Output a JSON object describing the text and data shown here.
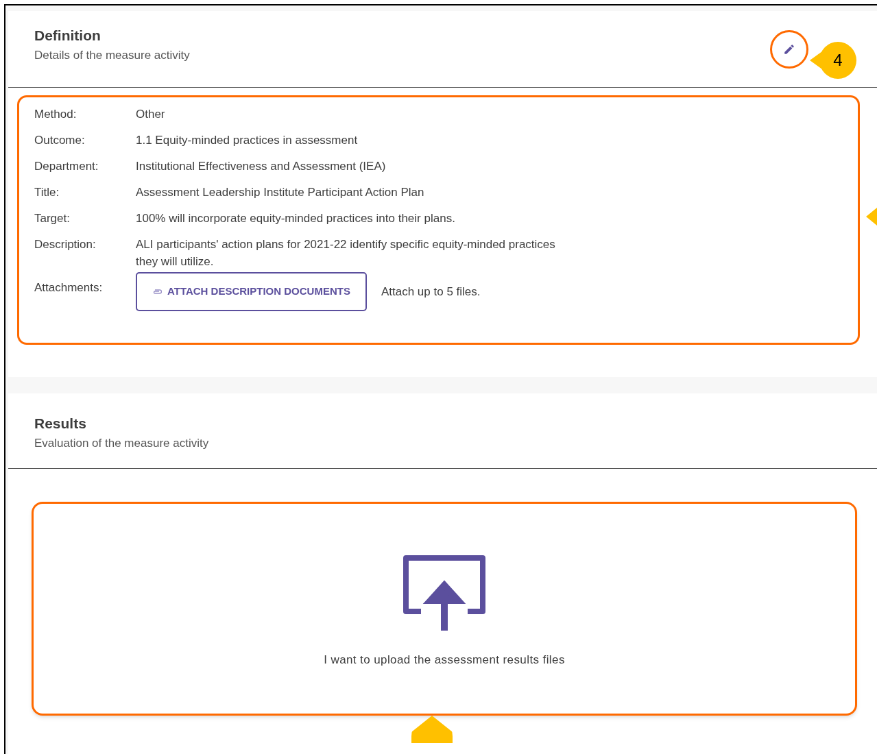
{
  "definition": {
    "title": "Definition",
    "subtitle": "Details of the measure activity",
    "callout": "4",
    "fields": [
      {
        "label": "Method:",
        "value": "Other"
      },
      {
        "label": "Outcome:",
        "value": "1.1 Equity-minded practices in assessment"
      },
      {
        "label": "Department:",
        "value": "Institutional Effectiveness and Assessment (IEA)"
      },
      {
        "label": "Title:",
        "value": "Assessment Leadership Institute Participant Action Plan"
      },
      {
        "label": "Target:",
        "value": "100% will incorporate equity-minded practices into their plans."
      },
      {
        "label": "Description:",
        "value": "ALI participants' action plans for 2021-22 identify specific equity-minded practices they will utilize."
      }
    ],
    "attachments": {
      "label": "Attachments:",
      "button": "ATTACH DESCRIPTION DOCUMENTS",
      "hint": "Attach up to 5 files."
    }
  },
  "results": {
    "title": "Results",
    "subtitle": "Evaluation of the measure activity",
    "upload_text": "I want to upload the assessment results files"
  }
}
